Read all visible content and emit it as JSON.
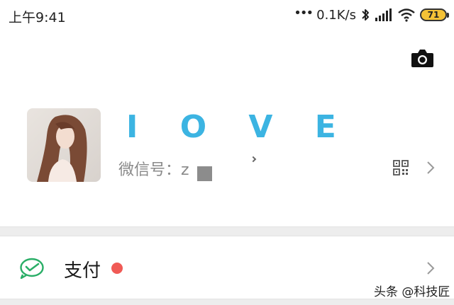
{
  "status_bar": {
    "time": "上午9:41",
    "dots": "•••",
    "net_speed": "0.1K/s",
    "battery": "71",
    "battery_color": "#f4c236"
  },
  "profile": {
    "nickname": "I O V E",
    "wechat_id": "微信号：z",
    "nickname_color": "#3cb4e2"
  },
  "icons": {
    "camera": "camera-icon",
    "qr_code": "qr-code-icon",
    "chevron": "chevron-right-icon",
    "pay": "wechat-pay-icon",
    "bluetooth": "bluetooth-icon",
    "signal": "signal-icon",
    "wifi": "wifi-icon"
  },
  "menu": {
    "pay_label": "支付",
    "badge_color": "#f05a55",
    "pay_icon_color": "#2aae67"
  },
  "watermark": "头条 @科技匠"
}
